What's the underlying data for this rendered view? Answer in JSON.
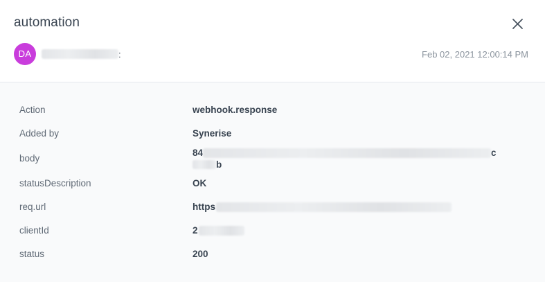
{
  "dialog": {
    "title": "automation",
    "close_icon": "close-icon"
  },
  "entry": {
    "avatar_initials": "DA",
    "avatar_color": "#c93ddc",
    "author_suffix": ":",
    "timestamp": "Feb 02, 2021 12:00:14 PM"
  },
  "details": {
    "action": {
      "label": "Action",
      "value": "webhook.response"
    },
    "added_by": {
      "label": "Added by",
      "value": "Synerise"
    },
    "body": {
      "label": "body",
      "value_line1_start": "84",
      "value_line1_end": "c",
      "value_line2_end": "b"
    },
    "status_description": {
      "label": "statusDescription",
      "value": "OK"
    },
    "req_url": {
      "label": "req.url",
      "value": "https"
    },
    "client_id": {
      "label": "clientId",
      "value": "2"
    },
    "status": {
      "label": "status",
      "value": "200"
    }
  }
}
